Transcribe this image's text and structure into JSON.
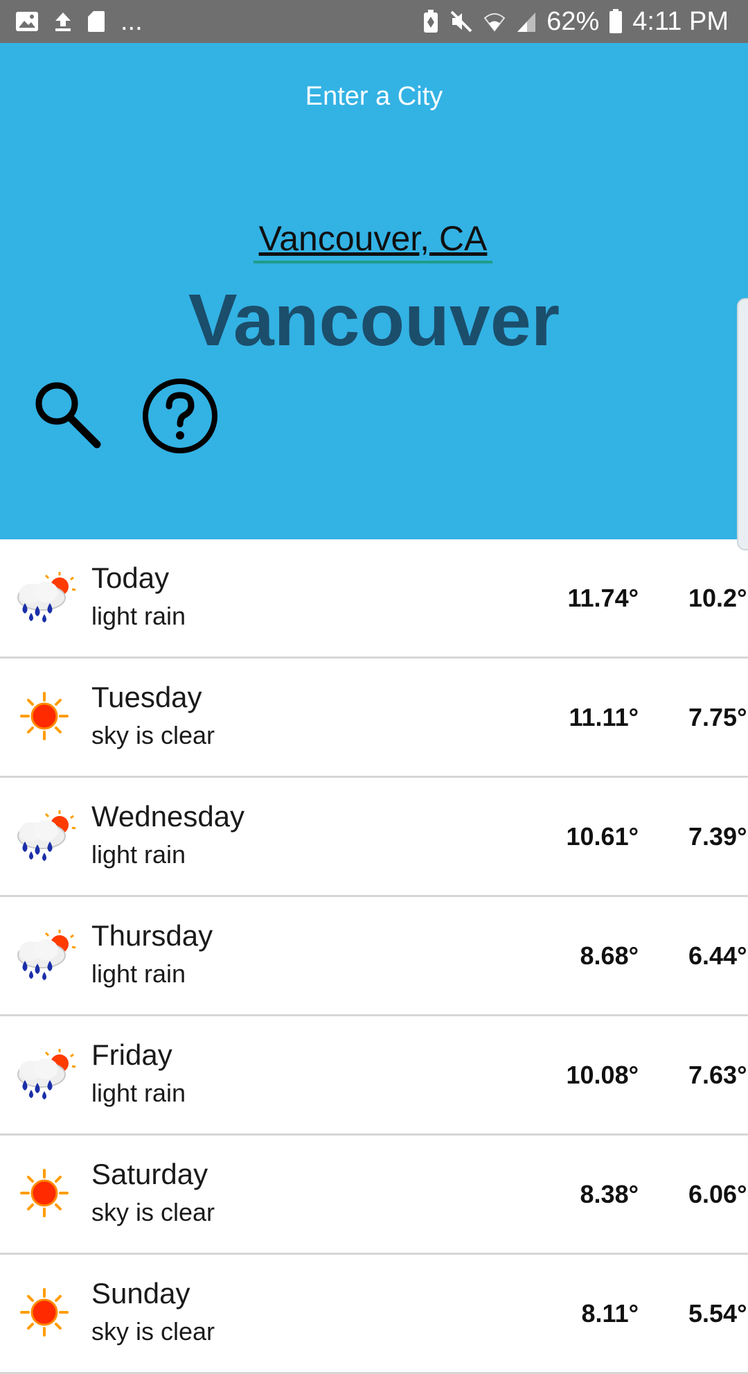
{
  "status_bar": {
    "overflow": "...",
    "battery": "62%",
    "time": "4:11 PM",
    "icons": [
      "image-icon",
      "upload-icon",
      "sd-card-icon",
      "battery-saver-icon",
      "mute-icon",
      "wifi-icon",
      "signal-icon",
      "battery-icon"
    ]
  },
  "header": {
    "prompt": "Enter a City",
    "city_input_value": "Vancouver, CA",
    "city_name": "Vancouver",
    "background": "#33b2e4",
    "heading_color": "#1b4e6b"
  },
  "forecast": [
    {
      "day": "Today",
      "desc": "light rain",
      "hi": "11.74°",
      "lo": "10.2°",
      "icon": "rain-sun-icon"
    },
    {
      "day": "Tuesday",
      "desc": "sky is clear",
      "hi": "11.11°",
      "lo": "7.75°",
      "icon": "sun-icon"
    },
    {
      "day": "Wednesday",
      "desc": "light rain",
      "hi": "10.61°",
      "lo": "7.39°",
      "icon": "rain-sun-icon"
    },
    {
      "day": "Thursday",
      "desc": "light rain",
      "hi": "8.68°",
      "lo": "6.44°",
      "icon": "rain-sun-icon"
    },
    {
      "day": "Friday",
      "desc": "light rain",
      "hi": "10.08°",
      "lo": "7.63°",
      "icon": "rain-sun-icon"
    },
    {
      "day": "Saturday",
      "desc": "sky is clear",
      "hi": "8.38°",
      "lo": "6.06°",
      "icon": "sun-icon"
    },
    {
      "day": "Sunday",
      "desc": "sky is clear",
      "hi": "8.11°",
      "lo": "5.54°",
      "icon": "sun-icon"
    }
  ]
}
